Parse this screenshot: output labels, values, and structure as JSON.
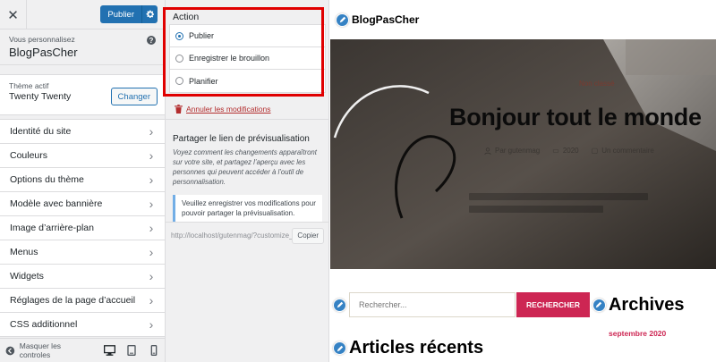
{
  "sidebar": {
    "close_label": "✕",
    "publish_label": "Publier",
    "customizing_label": "Vous personnalisez",
    "site_name": "BlogPasCher",
    "help_label": "?",
    "theme_label": "Thème actif",
    "theme_name": "Twenty Twenty",
    "change_label": "Changer",
    "menu_items": [
      {
        "label": "Identité du site"
      },
      {
        "label": "Couleurs"
      },
      {
        "label": "Options du thème"
      },
      {
        "label": "Modèle avec bannière"
      },
      {
        "label": "Image d’arrière-plan"
      },
      {
        "label": "Menus"
      },
      {
        "label": "Widgets"
      },
      {
        "label": "Réglages de la page d’accueil"
      },
      {
        "label": "CSS additionnel"
      }
    ],
    "hide_controls_label": "Masquer les controles"
  },
  "publish_panel": {
    "action_title": "Action",
    "options": [
      {
        "label": "Publier",
        "checked": true
      },
      {
        "label": "Enregistrer le brouillon",
        "checked": false
      },
      {
        "label": "Planifier",
        "checked": false
      }
    ],
    "discard_label": "Annuler les modifications",
    "share_title": "Partager le lien de prévisualisation",
    "share_description": "Voyez comment les changements apparaîtront sur votre site, et partagez l’aperçu avec les personnes qui peuvent accéder à l’outil de personnalisation.",
    "notice": "Veuillez enregistrer vos modifications pour pouvoir partager la prévisualisation.",
    "preview_url": "http://localhost/gutenmag/?customize_changeset_uuid",
    "copy_label": "Copier"
  },
  "preview": {
    "site_title": "BlogPasCher",
    "category": "Non classé",
    "post_title": "Bonjour tout le monde",
    "author": "Par gutenmag",
    "date": "2020",
    "comment": "Un commentaire",
    "search_placeholder": "Rechercher...",
    "search_button": "RECHERCHER",
    "archives_title": "Archives",
    "archives_month": "septembre 2020",
    "recent_title": "Articles récents"
  },
  "colors": {
    "accent": "#2271b1",
    "danger": "#b32d2e",
    "highlight_frame": "#e00000",
    "site_accent": "#cd2653"
  }
}
